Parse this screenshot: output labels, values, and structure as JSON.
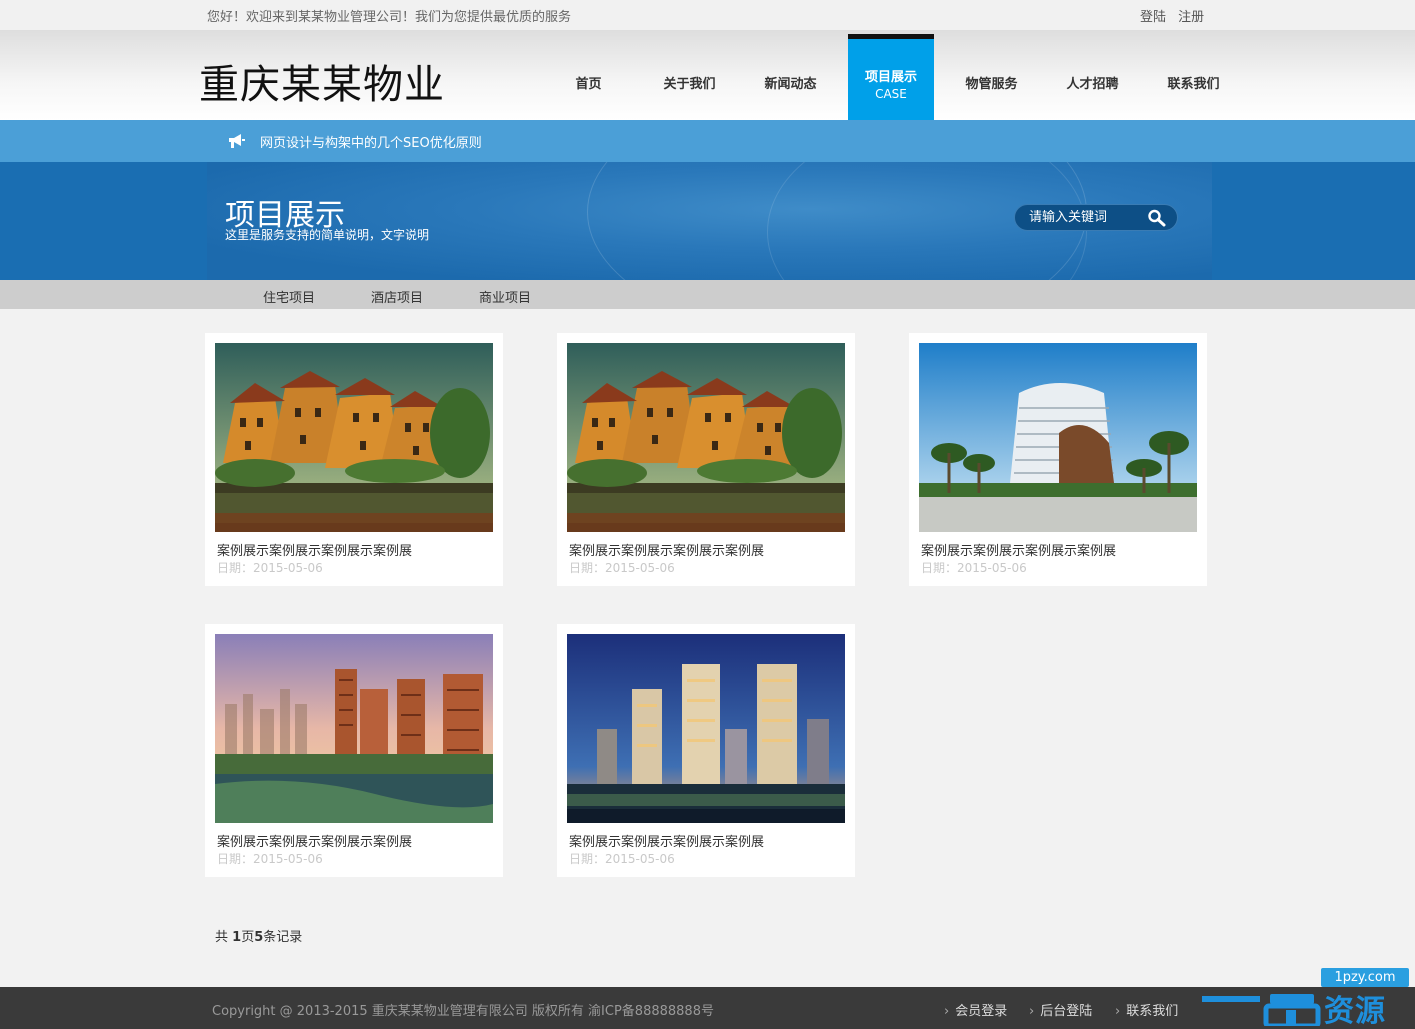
{
  "topbar": {
    "welcome": "您好！欢迎来到某某物业管理公司！我们为您提供最优质的服务",
    "login": "登陆",
    "register": "注册"
  },
  "header": {
    "logo": "重庆某某物业",
    "nav": [
      {
        "label": "首页",
        "sub": ""
      },
      {
        "label": "关于我们",
        "sub": ""
      },
      {
        "label": "新闻动态",
        "sub": ""
      },
      {
        "label": "项目展示",
        "sub": "CASE",
        "active": true
      },
      {
        "label": "物管服务",
        "sub": ""
      },
      {
        "label": "人才招聘",
        "sub": ""
      },
      {
        "label": "联系我们",
        "sub": ""
      }
    ]
  },
  "notice": {
    "icon": "megaphone-icon",
    "text": "网页设计与构架中的几个SEO优化原则"
  },
  "banner": {
    "title": "项目展示",
    "subtitle": "这里是服务支持的简单说明，文字说明",
    "search_placeholder": "请输入关键词"
  },
  "categories": [
    "住宅项目",
    "酒店项目",
    "商业项目"
  ],
  "cards": [
    {
      "caption": "案例展示案例展示案例展示案例展",
      "date": "日期：2015-05-06",
      "image": "villa"
    },
    {
      "caption": "案例展示案例展示案例展示案例展",
      "date": "日期：2015-05-06",
      "image": "villa"
    },
    {
      "caption": "案例展示案例展示案例展示案例展",
      "date": "日期：2015-05-06",
      "image": "hotel"
    },
    {
      "caption": "案例展示案例展示案例展示案例展",
      "date": "日期：2015-05-06",
      "image": "towers-sunset"
    },
    {
      "caption": "案例展示案例展示案例展示案例展",
      "date": "日期：2015-05-06",
      "image": "towers-night"
    }
  ],
  "pager": {
    "prefix": "共 ",
    "pages": "1",
    "mid": "页",
    "records": "5",
    "suffix": "条记录"
  },
  "footer": {
    "copyright": "Copyright @ 2013-2015 重庆某某物业管理有限公司 版权所有 渝ICP备88888888号",
    "links": [
      "会员登录",
      "后台登陆",
      "联系我们"
    ]
  },
  "watermark": {
    "domain": "1pzy.com",
    "name": "资源网"
  },
  "colors": {
    "accent": "#00a0e9",
    "notice_bar": "#4b9fd7",
    "banner": "#1a6eb2",
    "footer": "#3a3a3a"
  }
}
